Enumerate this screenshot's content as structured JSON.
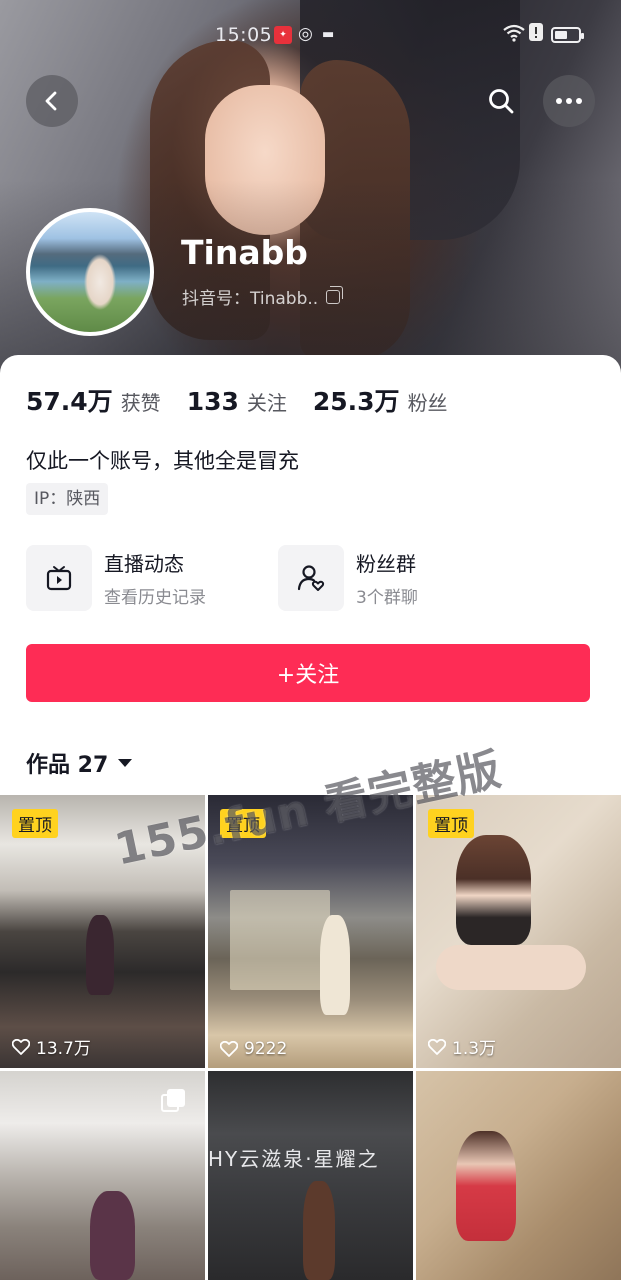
{
  "status_bar": {
    "time": "15:05"
  },
  "header": {
    "back_label": "back",
    "search_label": "search",
    "more_label": "more"
  },
  "profile": {
    "name": "Tinabb",
    "douyin_id": "抖音号：Tinabb..",
    "stats": [
      {
        "value": "57.4万",
        "label": "获赞"
      },
      {
        "value": "133",
        "label": "关注"
      },
      {
        "value": "25.3万",
        "label": "粉丝"
      }
    ],
    "bio": "仅此一个账号，其他全是冒充",
    "ip": "IP：陕西"
  },
  "features": [
    {
      "title": "直播动态",
      "subtitle": "查看历史记录",
      "icon": "tv-icon"
    },
    {
      "title": "粉丝群",
      "subtitle": "3个群聊",
      "icon": "group-user-icon"
    }
  ],
  "follow_button": "+关注",
  "works_tab": {
    "label": "作品 27"
  },
  "videos": [
    {
      "pinned": "置顶",
      "likes": "13.7万"
    },
    {
      "pinned": "置顶",
      "likes": "9222"
    },
    {
      "pinned": "置顶",
      "likes": "1.3万"
    },
    {
      "pinned": "",
      "likes": ""
    },
    {
      "pinned": "",
      "likes": "",
      "poster_text": "HY云滋泉·星耀之"
    },
    {
      "pinned": "",
      "likes": ""
    }
  ],
  "watermark": "155.fun 看完整版",
  "colors": {
    "accent": "#fe2c55",
    "pin_badge": "#ffd21f"
  }
}
